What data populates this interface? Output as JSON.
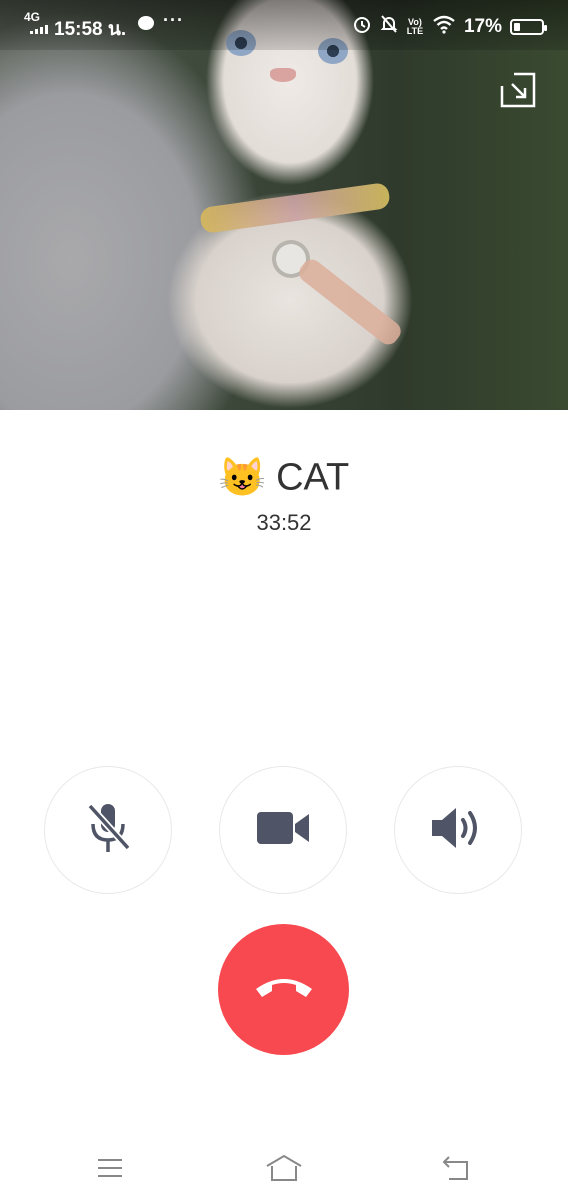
{
  "status_bar": {
    "network": "4G",
    "time": "15:58 น.",
    "more": "···",
    "volte": "Vo) LTE",
    "battery": "17%",
    "icons": [
      "signal-icon",
      "chat-bubble-icon",
      "alarm-icon",
      "mute-notification-icon",
      "volte-icon",
      "wifi-icon",
      "battery-icon"
    ]
  },
  "call": {
    "caller_emoji": "😺",
    "caller_name": "CAT",
    "duration": "33:52"
  },
  "controls": {
    "mute_icon": "mic-off-icon",
    "video_icon": "video-camera-icon",
    "speaker_icon": "speaker-icon",
    "end_icon": "end-call-icon",
    "minimize_icon": "minimize-icon"
  },
  "colors": {
    "end_call": "#f7494f",
    "icon": "#4f5566",
    "text": "#333333"
  },
  "nav": {
    "icons": [
      "menu-icon",
      "home-icon",
      "back-icon"
    ]
  }
}
